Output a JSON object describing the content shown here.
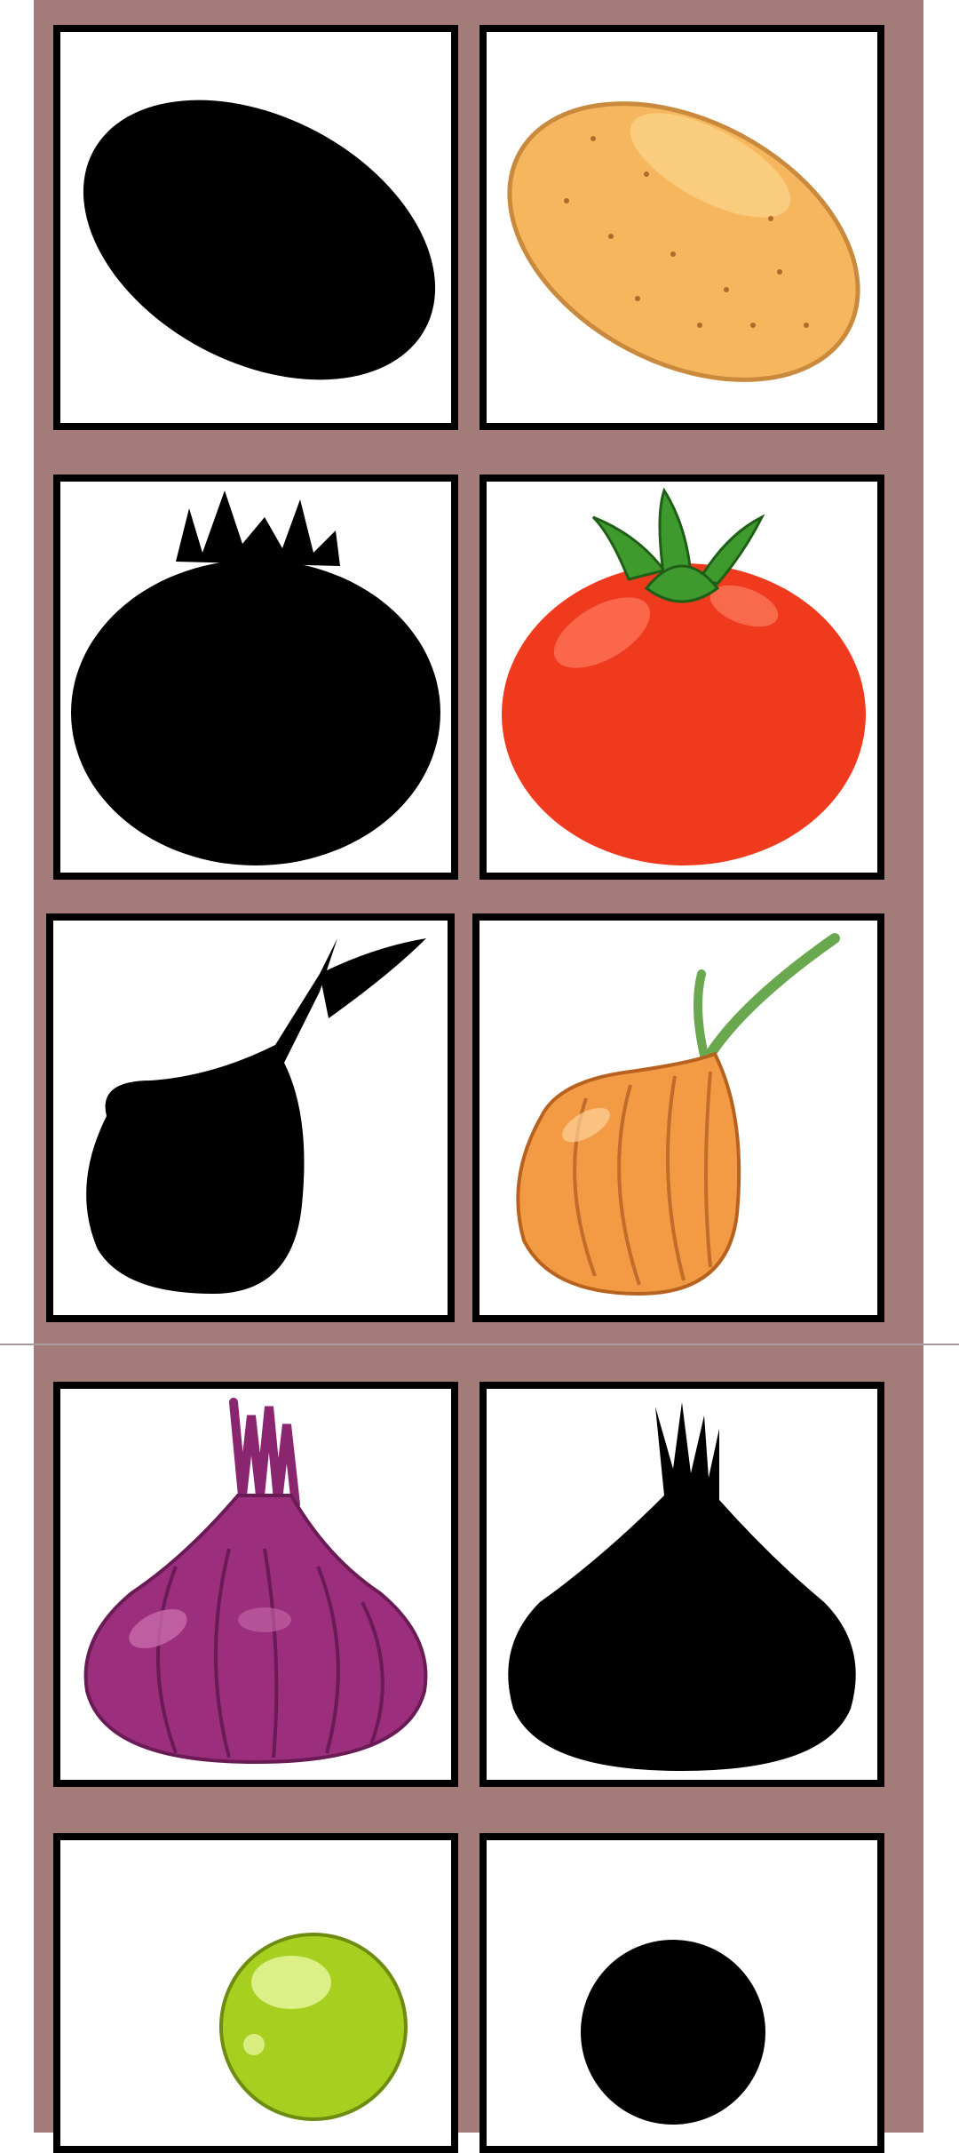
{
  "palette": {
    "frame": "#a37b79",
    "card_border": "#000000",
    "card_background": "#ffffff",
    "silhouette": "#000000"
  },
  "rows": [
    {
      "left": {
        "kind": "silhouette",
        "item": "potato-icon"
      },
      "right": {
        "kind": "picture",
        "item": "potato-icon",
        "colors": {
          "body": "#f5b65d",
          "edge": "#c98a3e"
        }
      }
    },
    {
      "left": {
        "kind": "silhouette",
        "item": "tomato-icon"
      },
      "right": {
        "kind": "picture",
        "item": "tomato-icon",
        "colors": {
          "body": "#f03a1e",
          "leaves": "#3f9a2e"
        }
      }
    },
    {
      "left": {
        "kind": "silhouette",
        "item": "onion-icon"
      },
      "right": {
        "kind": "picture",
        "item": "onion-icon",
        "colors": {
          "body": "#f29a44",
          "sprout": "#6aa84f"
        }
      }
    },
    {
      "left": {
        "kind": "picture",
        "item": "red-onion-icon",
        "colors": {
          "body": "#9b2f7d",
          "highlight": "#c86aa9"
        }
      },
      "right": {
        "kind": "silhouette",
        "item": "red-onion-icon"
      }
    },
    {
      "left": {
        "kind": "picture",
        "item": "pea-icon",
        "colors": {
          "body": "#a7cf1f",
          "highlight": "#e6f59a"
        }
      },
      "right": {
        "kind": "silhouette",
        "item": "pea-icon"
      }
    }
  ]
}
